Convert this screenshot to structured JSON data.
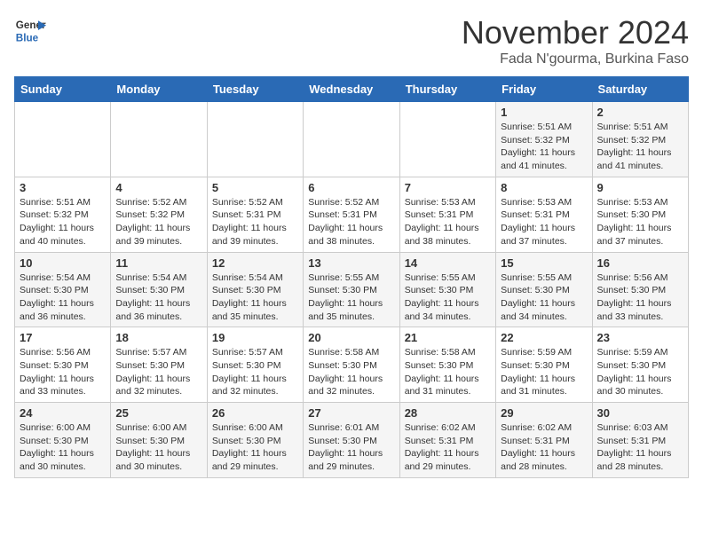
{
  "header": {
    "logo_line1": "General",
    "logo_line2": "Blue",
    "month": "November 2024",
    "location": "Fada N'gourma, Burkina Faso"
  },
  "weekdays": [
    "Sunday",
    "Monday",
    "Tuesday",
    "Wednesday",
    "Thursday",
    "Friday",
    "Saturday"
  ],
  "weeks": [
    [
      {
        "day": "",
        "info": ""
      },
      {
        "day": "",
        "info": ""
      },
      {
        "day": "",
        "info": ""
      },
      {
        "day": "",
        "info": ""
      },
      {
        "day": "",
        "info": ""
      },
      {
        "day": "1",
        "info": "Sunrise: 5:51 AM\nSunset: 5:32 PM\nDaylight: 11 hours and 41 minutes."
      },
      {
        "day": "2",
        "info": "Sunrise: 5:51 AM\nSunset: 5:32 PM\nDaylight: 11 hours and 41 minutes."
      }
    ],
    [
      {
        "day": "3",
        "info": "Sunrise: 5:51 AM\nSunset: 5:32 PM\nDaylight: 11 hours and 40 minutes."
      },
      {
        "day": "4",
        "info": "Sunrise: 5:52 AM\nSunset: 5:32 PM\nDaylight: 11 hours and 39 minutes."
      },
      {
        "day": "5",
        "info": "Sunrise: 5:52 AM\nSunset: 5:31 PM\nDaylight: 11 hours and 39 minutes."
      },
      {
        "day": "6",
        "info": "Sunrise: 5:52 AM\nSunset: 5:31 PM\nDaylight: 11 hours and 38 minutes."
      },
      {
        "day": "7",
        "info": "Sunrise: 5:53 AM\nSunset: 5:31 PM\nDaylight: 11 hours and 38 minutes."
      },
      {
        "day": "8",
        "info": "Sunrise: 5:53 AM\nSunset: 5:31 PM\nDaylight: 11 hours and 37 minutes."
      },
      {
        "day": "9",
        "info": "Sunrise: 5:53 AM\nSunset: 5:30 PM\nDaylight: 11 hours and 37 minutes."
      }
    ],
    [
      {
        "day": "10",
        "info": "Sunrise: 5:54 AM\nSunset: 5:30 PM\nDaylight: 11 hours and 36 minutes."
      },
      {
        "day": "11",
        "info": "Sunrise: 5:54 AM\nSunset: 5:30 PM\nDaylight: 11 hours and 36 minutes."
      },
      {
        "day": "12",
        "info": "Sunrise: 5:54 AM\nSunset: 5:30 PM\nDaylight: 11 hours and 35 minutes."
      },
      {
        "day": "13",
        "info": "Sunrise: 5:55 AM\nSunset: 5:30 PM\nDaylight: 11 hours and 35 minutes."
      },
      {
        "day": "14",
        "info": "Sunrise: 5:55 AM\nSunset: 5:30 PM\nDaylight: 11 hours and 34 minutes."
      },
      {
        "day": "15",
        "info": "Sunrise: 5:55 AM\nSunset: 5:30 PM\nDaylight: 11 hours and 34 minutes."
      },
      {
        "day": "16",
        "info": "Sunrise: 5:56 AM\nSunset: 5:30 PM\nDaylight: 11 hours and 33 minutes."
      }
    ],
    [
      {
        "day": "17",
        "info": "Sunrise: 5:56 AM\nSunset: 5:30 PM\nDaylight: 11 hours and 33 minutes."
      },
      {
        "day": "18",
        "info": "Sunrise: 5:57 AM\nSunset: 5:30 PM\nDaylight: 11 hours and 32 minutes."
      },
      {
        "day": "19",
        "info": "Sunrise: 5:57 AM\nSunset: 5:30 PM\nDaylight: 11 hours and 32 minutes."
      },
      {
        "day": "20",
        "info": "Sunrise: 5:58 AM\nSunset: 5:30 PM\nDaylight: 11 hours and 32 minutes."
      },
      {
        "day": "21",
        "info": "Sunrise: 5:58 AM\nSunset: 5:30 PM\nDaylight: 11 hours and 31 minutes."
      },
      {
        "day": "22",
        "info": "Sunrise: 5:59 AM\nSunset: 5:30 PM\nDaylight: 11 hours and 31 minutes."
      },
      {
        "day": "23",
        "info": "Sunrise: 5:59 AM\nSunset: 5:30 PM\nDaylight: 11 hours and 30 minutes."
      }
    ],
    [
      {
        "day": "24",
        "info": "Sunrise: 6:00 AM\nSunset: 5:30 PM\nDaylight: 11 hours and 30 minutes."
      },
      {
        "day": "25",
        "info": "Sunrise: 6:00 AM\nSunset: 5:30 PM\nDaylight: 11 hours and 30 minutes."
      },
      {
        "day": "26",
        "info": "Sunrise: 6:00 AM\nSunset: 5:30 PM\nDaylight: 11 hours and 29 minutes."
      },
      {
        "day": "27",
        "info": "Sunrise: 6:01 AM\nSunset: 5:30 PM\nDaylight: 11 hours and 29 minutes."
      },
      {
        "day": "28",
        "info": "Sunrise: 6:02 AM\nSunset: 5:31 PM\nDaylight: 11 hours and 29 minutes."
      },
      {
        "day": "29",
        "info": "Sunrise: 6:02 AM\nSunset: 5:31 PM\nDaylight: 11 hours and 28 minutes."
      },
      {
        "day": "30",
        "info": "Sunrise: 6:03 AM\nSunset: 5:31 PM\nDaylight: 11 hours and 28 minutes."
      }
    ]
  ]
}
